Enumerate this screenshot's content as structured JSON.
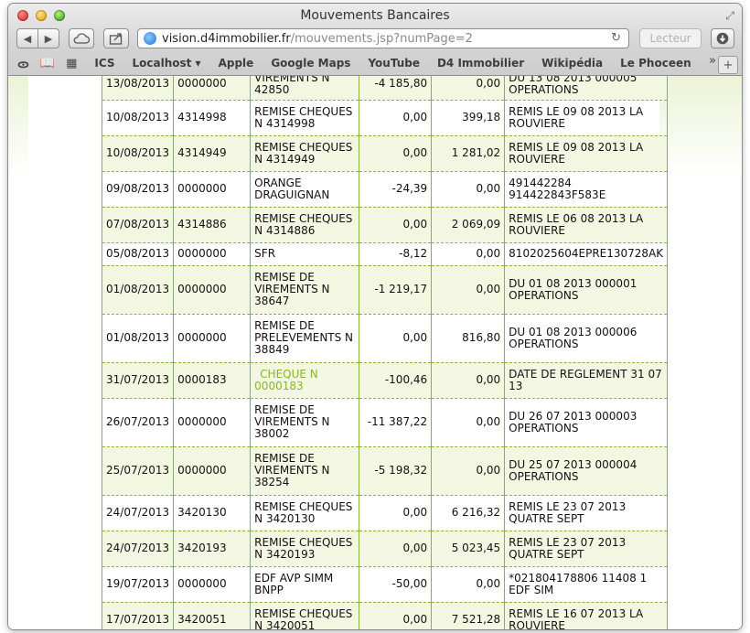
{
  "window": {
    "title": "Mouvements Bancaires"
  },
  "toolbar": {
    "url_host": "vision.d4immobilier.fr",
    "url_path": "/mouvements.jsp?numPage=2",
    "reader_label": "Lecteur"
  },
  "bookmarks": [
    "ICS",
    "Localhost ▾",
    "Apple",
    "Google Maps",
    "YouTube",
    "D4 Immobilier",
    "Wikipédia",
    "Le Phoceen"
  ],
  "rows": [
    {
      "date": "13/08/2013",
      "num": "0000000",
      "lib": "VIREMENTS N 42850",
      "debit": "-4 185,80",
      "credit": "0,00",
      "info": "DU 13 08 2013 000005 OPERATIONS",
      "h": 34
    },
    {
      "date": "10/08/2013",
      "num": "4314998",
      "lib": "REMISE CHEQUES N 4314998",
      "debit": "0,00",
      "credit": "399,18",
      "info": "REMIS LE 09 08 2013 LA ROUVIERE",
      "h": 39
    },
    {
      "date": "10/08/2013",
      "num": "4314949",
      "lib": "REMISE CHEQUES N 4314949",
      "debit": "0,00",
      "credit": "1 281,02",
      "info": "REMIS LE 09 08 2013 LA ROUVIERE",
      "h": 39
    },
    {
      "date": "09/08/2013",
      "num": "0000000",
      "lib": "ORANGE DRAGUIGNAN",
      "debit": "-24,39",
      "credit": "0,00",
      "info": "491442284 914422843F583E",
      "h": 39
    },
    {
      "date": "07/08/2013",
      "num": "4314886",
      "lib": "REMISE CHEQUES N 4314886",
      "debit": "0,00",
      "credit": "2 069,09",
      "info": "REMIS LE 06 08 2013 LA ROUVIERE",
      "h": 39
    },
    {
      "date": "05/08/2013",
      "num": "0000000",
      "lib": "SFR",
      "debit": "-8,12",
      "credit": "0,00",
      "info": "8102025604EPRE130728AK",
      "h": 25
    },
    {
      "date": "01/08/2013",
      "num": "0000000",
      "lib": "REMISE DE VIREMENTS N 38647",
      "debit": "-1 219,17",
      "credit": "0,00",
      "info": "DU 01 08 2013 000001 OPERATIONS",
      "h": 53
    },
    {
      "date": "01/08/2013",
      "num": "0000000",
      "lib": "REMISE DE PRELEVEMENTS N 38849",
      "debit": "0,00",
      "credit": "816,80",
      "info": "DU 01 08 2013 000006 OPERATIONS",
      "h": 53
    },
    {
      "date": "31/07/2013",
      "num": "0000183",
      "lib": "CHEQUE N 0000183",
      "debit": "-100,46",
      "credit": "0,00",
      "info": "DATE DE REGLEMENT 31 07 13",
      "h": 39,
      "link": true
    },
    {
      "date": "26/07/2013",
      "num": "0000000",
      "lib": "REMISE DE VIREMENTS N 38002",
      "debit": "-11 387,22",
      "credit": "0,00",
      "info": "DU 26 07 2013 000003 OPERATIONS",
      "h": 53
    },
    {
      "date": "25/07/2013",
      "num": "0000000",
      "lib": "REMISE DE VIREMENTS N 38254",
      "debit": "-5 198,32",
      "credit": "0,00",
      "info": "DU 25 07 2013 000004 OPERATIONS",
      "h": 53
    },
    {
      "date": "24/07/2013",
      "num": "3420130",
      "lib": "REMISE CHEQUES N 3420130",
      "debit": "0,00",
      "credit": "6 216,32",
      "info": "REMIS LE 23 07 2013 QUATRE SEPT",
      "h": 39
    },
    {
      "date": "24/07/2013",
      "num": "3420193",
      "lib": "REMISE CHEQUES N 3420193",
      "debit": "0,00",
      "credit": "5 023,45",
      "info": "REMIS LE 23 07 2013 QUATRE SEPT",
      "h": 39
    },
    {
      "date": "19/07/2013",
      "num": "0000000",
      "lib": "EDF AVP SIMM BNPP",
      "debit": "-50,00",
      "credit": "0,00",
      "info": "*021804178806 11408 1 EDF SIM",
      "h": 39
    },
    {
      "date": "17/07/2013",
      "num": "3420051",
      "lib": "REMISE CHEQUES N 3420051",
      "debit": "0,00",
      "credit": "7 521,28",
      "info": "REMIS LE 16 07 2013 LA ROUVIERE",
      "h": 39
    }
  ]
}
